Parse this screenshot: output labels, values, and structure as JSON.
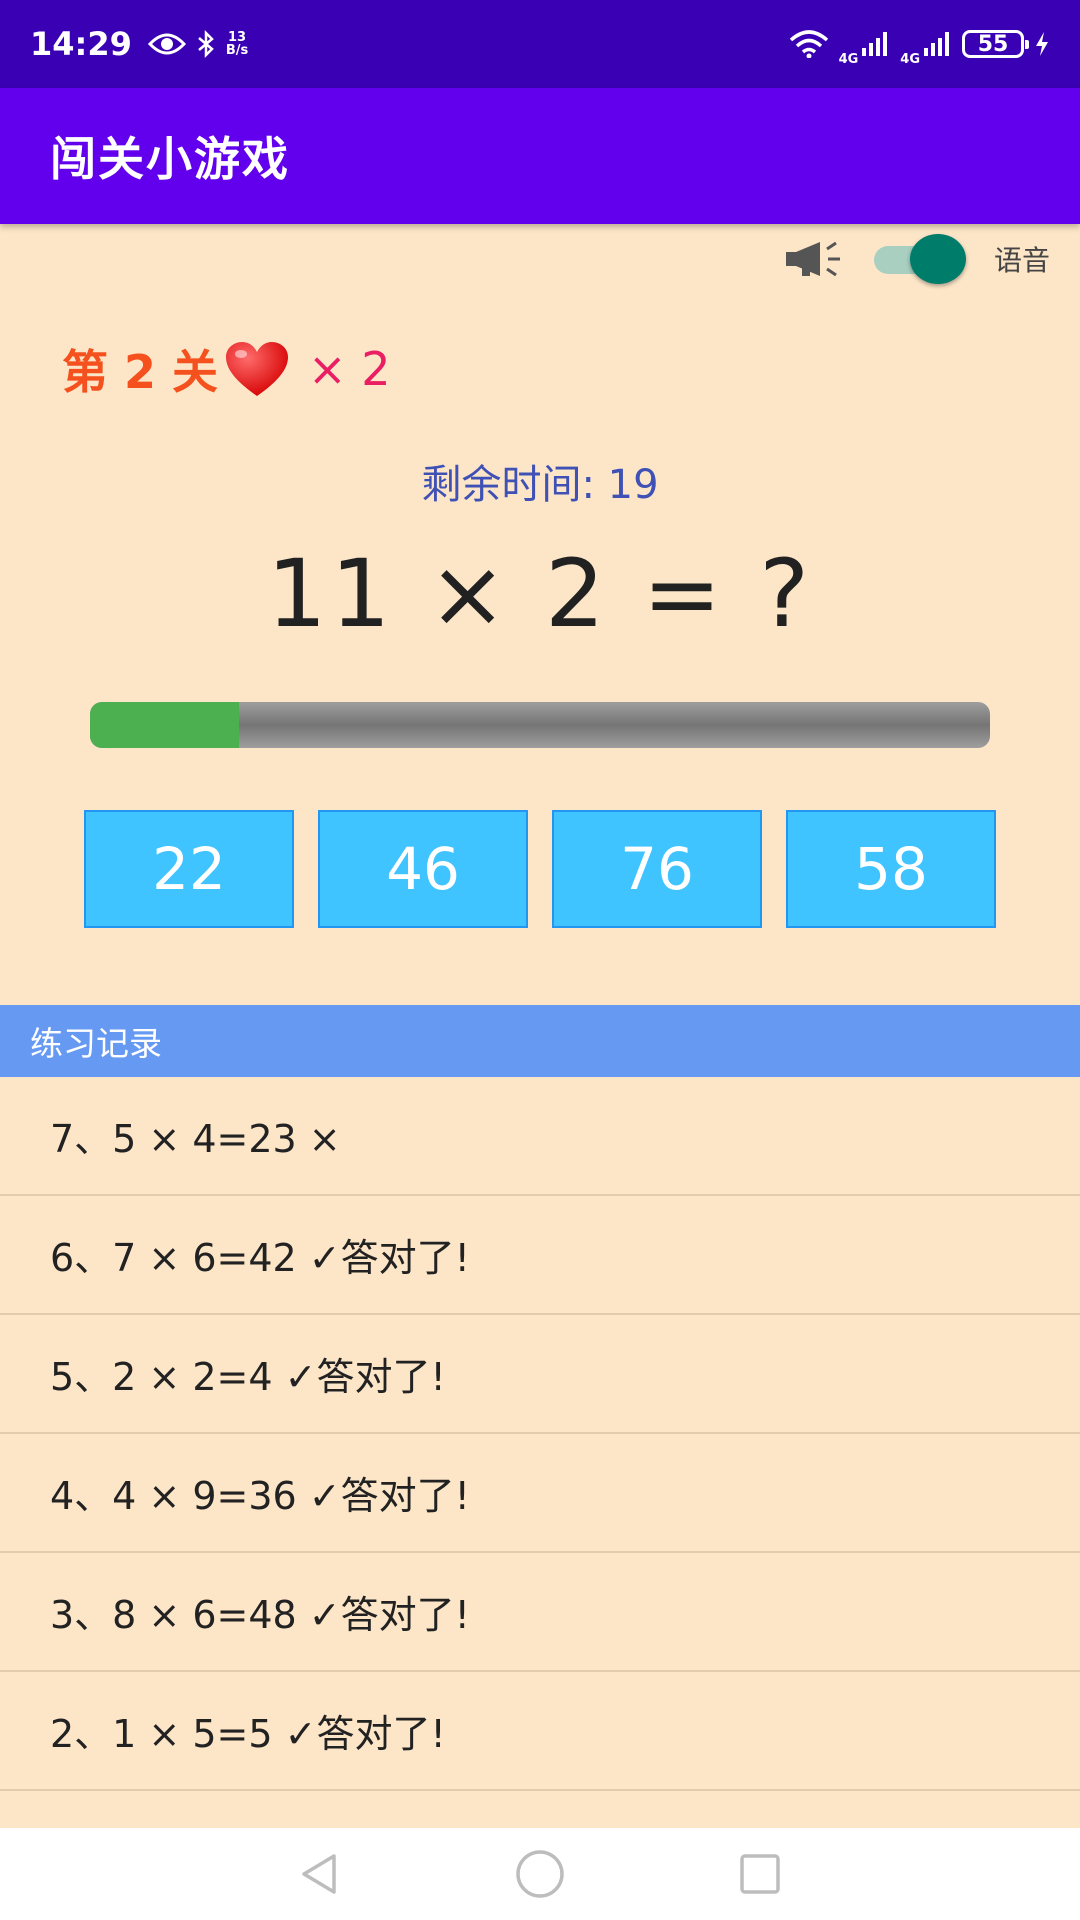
{
  "status_bar": {
    "time": "14:29",
    "net_speed_value": "13",
    "net_speed_unit": "B/s",
    "signal1_label": "4G",
    "signal2_label": "4G",
    "battery": "55"
  },
  "app_bar": {
    "title": "闯关小游戏"
  },
  "voice": {
    "label": "语音",
    "enabled": true
  },
  "level": {
    "text": "第 2 关",
    "lives": "× 2"
  },
  "timer": {
    "text": "剩余时间: 19"
  },
  "question": {
    "text": "11 × 2 = ?"
  },
  "progress": {
    "fraction": 0.165
  },
  "answers": [
    "22",
    "46",
    "76",
    "58"
  ],
  "records": {
    "header": "练习记录",
    "items": [
      "7、5 × 4=23 ×",
      "6、7 × 6=42 ✓答对了!",
      "5、2 × 2=4 ✓答对了!",
      "4、4 × 9=36 ✓答对了!",
      "3、8 × 6=48 ✓答对了!",
      "2、1 × 5=5 ✓答对了!"
    ]
  },
  "colors": {
    "status_bar": "#3A00B3",
    "app_bar": "#6200EE",
    "background": "#FDE6C8",
    "level": "#F4511E",
    "timer": "#3F51B5",
    "answer_button": "#40C4FF",
    "progress_fill": "#4CAF50",
    "record_header": "#6699F2"
  },
  "icons": {
    "status": [
      "eye-icon",
      "bluetooth-icon",
      "wifi-icon",
      "signal-icon",
      "battery-icon",
      "charging-icon"
    ],
    "voice": "megaphone-icon",
    "level": "heart-icon",
    "nav": [
      "back-icon",
      "home-icon",
      "recents-icon"
    ]
  }
}
